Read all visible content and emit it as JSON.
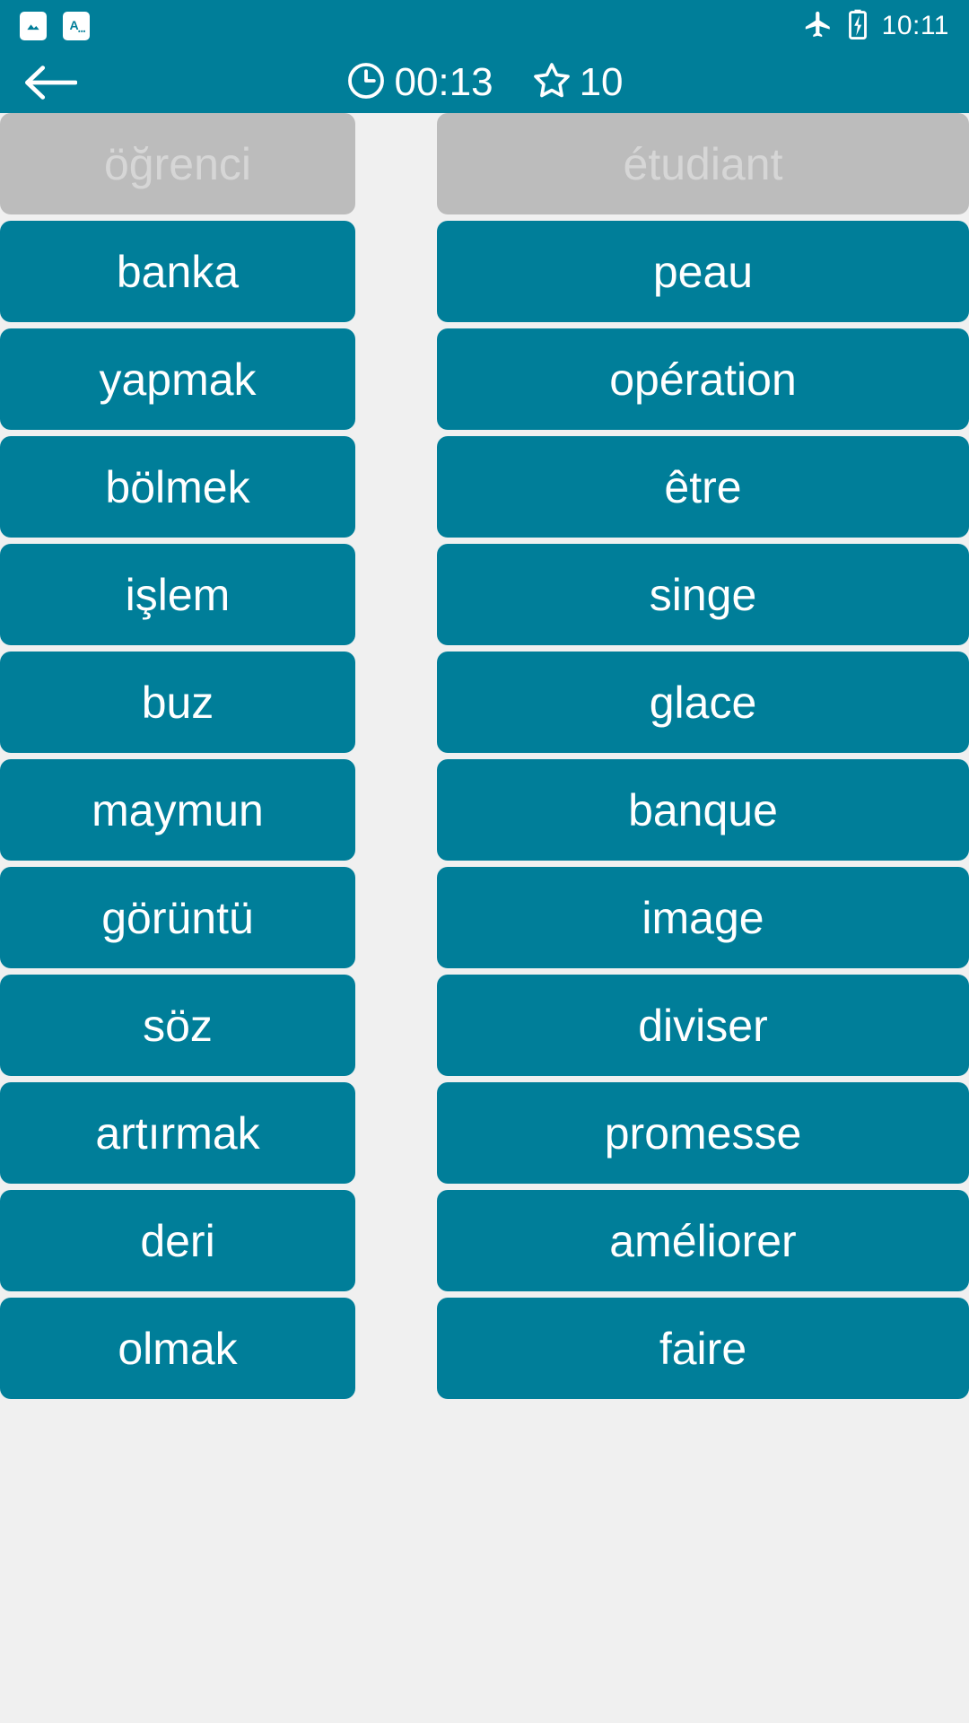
{
  "status_bar": {
    "time": "10:11",
    "icons": [
      "image-notification-icon",
      "translate-notification-icon",
      "airplane-mode-icon",
      "battery-charging-icon"
    ]
  },
  "app_bar": {
    "back_label": "←",
    "timer": "00:13",
    "score": "10",
    "timer_icon": "clock-icon",
    "score_icon": "star-icon"
  },
  "colors": {
    "accent": "#007E99",
    "matched_card": "#bcbcbc",
    "matched_text": "#d6d6d6",
    "background": "#f0f0f0",
    "card_text": "#ffffff"
  },
  "board": {
    "left_column": [
      {
        "text": "öğrenci",
        "matched": true
      },
      {
        "text": "banka",
        "matched": false
      },
      {
        "text": "yapmak",
        "matched": false
      },
      {
        "text": "bölmek",
        "matched": false
      },
      {
        "text": "işlem",
        "matched": false
      },
      {
        "text": "buz",
        "matched": false
      },
      {
        "text": "maymun",
        "matched": false
      },
      {
        "text": "görüntü",
        "matched": false
      },
      {
        "text": "söz",
        "matched": false
      },
      {
        "text": "artırmak",
        "matched": false
      },
      {
        "text": "deri",
        "matched": false
      },
      {
        "text": "olmak",
        "matched": false
      }
    ],
    "right_column": [
      {
        "text": "étudiant",
        "matched": true
      },
      {
        "text": "peau",
        "matched": false
      },
      {
        "text": "opération",
        "matched": false
      },
      {
        "text": "être",
        "matched": false
      },
      {
        "text": "singe",
        "matched": false
      },
      {
        "text": "glace",
        "matched": false
      },
      {
        "text": "banque",
        "matched": false
      },
      {
        "text": "image",
        "matched": false
      },
      {
        "text": "diviser",
        "matched": false
      },
      {
        "text": "promesse",
        "matched": false
      },
      {
        "text": "améliorer",
        "matched": false
      },
      {
        "text": "faire",
        "matched": false
      }
    ]
  }
}
